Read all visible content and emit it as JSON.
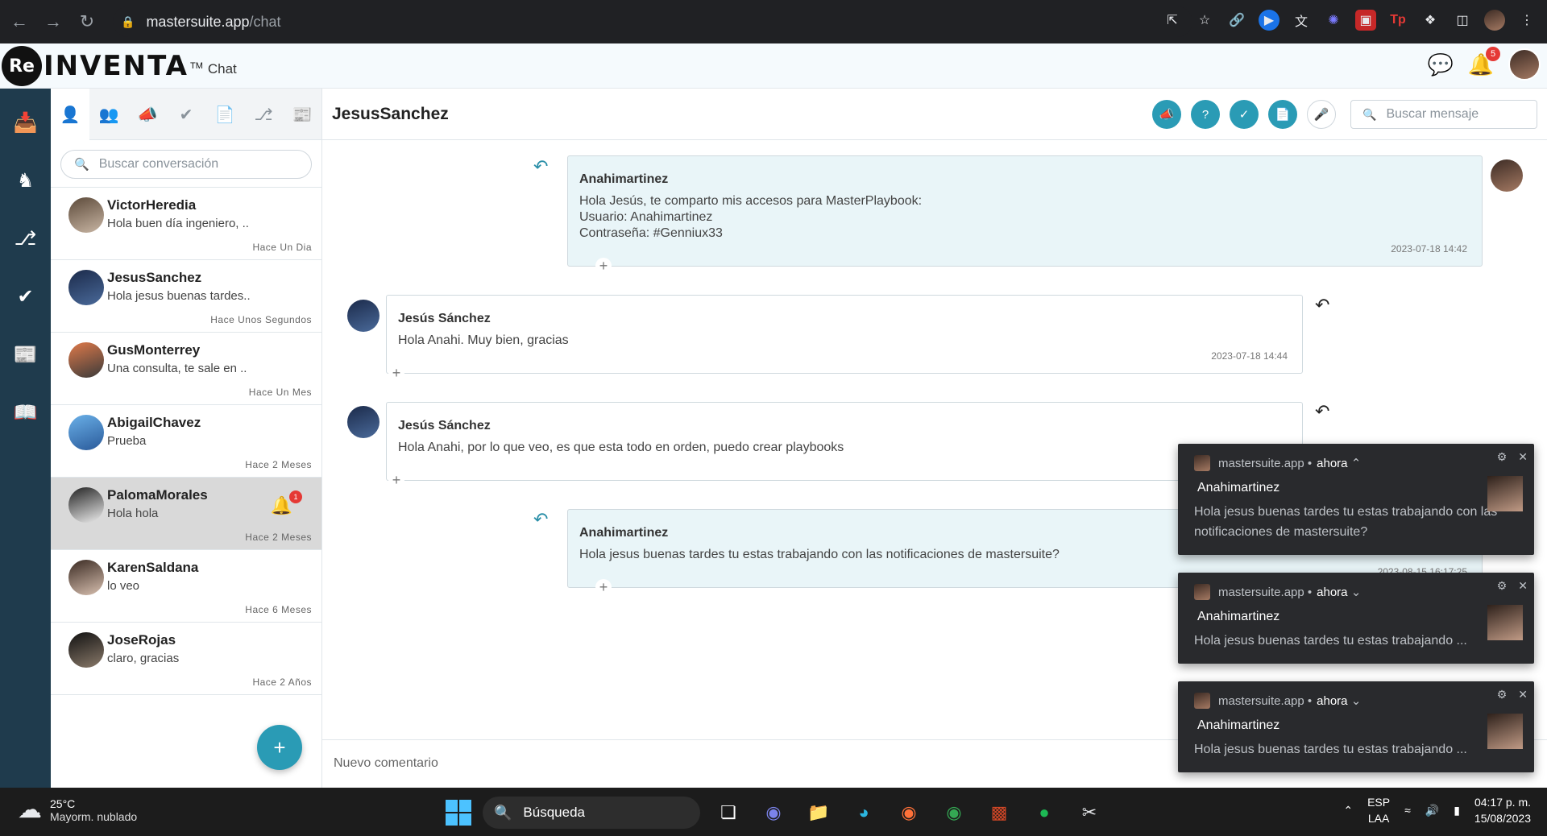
{
  "browser": {
    "url_host": "mastersuite.app",
    "url_path": "/chat"
  },
  "header": {
    "logo_mark": "Re",
    "logo_text": "INVENTA",
    "logo_tm": "TM",
    "app_name": "Chat",
    "notification_count": "5"
  },
  "conversations": {
    "search_placeholder": "Buscar conversación",
    "items": [
      {
        "name": "VictorHeredia",
        "snippet": "Hola buen día ingeniero, ..",
        "time": "Hace Un Dia"
      },
      {
        "name": "JesusSanchez",
        "snippet": "Hola jesus buenas tardes..",
        "time": "Hace Unos Segundos"
      },
      {
        "name": "GusMonterrey",
        "snippet": "Una consulta, te sale en ..",
        "time": "Hace Un Mes"
      },
      {
        "name": "AbigailChavez",
        "snippet": "Prueba",
        "time": "Hace 2 Meses"
      },
      {
        "name": "PalomaMorales",
        "snippet": "Hola hola",
        "time": "Hace 2 Meses",
        "unread": "1"
      },
      {
        "name": "KarenSaldana",
        "snippet": "lo veo",
        "time": "Hace 6 Meses"
      },
      {
        "name": "JoseRojas",
        "snippet": "claro, gracias",
        "time": "Hace 2 Años"
      }
    ],
    "fab_label": "+"
  },
  "chat": {
    "title": "JesusSanchez",
    "search_placeholder": "Buscar mensaje",
    "composer_placeholder": "Nuevo comentario",
    "messages": [
      {
        "author": "Anahimartinez",
        "lines": [
          "Hola Jesús, te comparto mis accesos para MasterPlaybook:",
          "Usuario: Anahimartinez",
          "Contraseña: #Genniux33"
        ],
        "time": "2023-07-18   14:42"
      },
      {
        "author": "Jesús Sánchez",
        "lines": [
          "Hola Anahi. Muy bien, gracias"
        ],
        "time": "2023-07-18   14:44"
      },
      {
        "author": "Jesús Sánchez",
        "lines": [
          "Hola Anahi, por lo que veo, es que esta todo en orden, puedo crear playbooks"
        ],
        "time": ""
      },
      {
        "author": "Anahimartinez",
        "lines": [
          "Hola jesus buenas tardes tu estas trabajando con las notificaciones de mastersuite?"
        ],
        "time": "2023-08-15   16:17:25"
      }
    ]
  },
  "notifications": [
    {
      "source": "mastersuite.app",
      "when": "ahora",
      "chevron": "^",
      "title": "Anahimartinez",
      "body": "Hola jesus buenas tardes tu estas trabajando con las notificaciones de mastersuite?"
    },
    {
      "source": "mastersuite.app",
      "when": "ahora",
      "chevron": "v",
      "title": "Anahimartinez",
      "body": "Hola jesus buenas tardes tu estas trabajando ..."
    },
    {
      "source": "mastersuite.app",
      "when": "ahora",
      "chevron": "v",
      "title": "Anahimartinez",
      "body": "Hola jesus buenas tardes tu estas trabajando ..."
    }
  ],
  "taskbar": {
    "temperature": "25°C",
    "weather": "Mayorm. nublado",
    "search_label": "Búsqueda",
    "lang_1": "ESP",
    "lang_2": "LAA",
    "time": "04:17 p. m.",
    "date": "15/08/2023"
  },
  "colors": {
    "accent": "#2a9bb5",
    "sidebar": "#1f3b4d",
    "my_bubble": "#e9f5f8"
  }
}
